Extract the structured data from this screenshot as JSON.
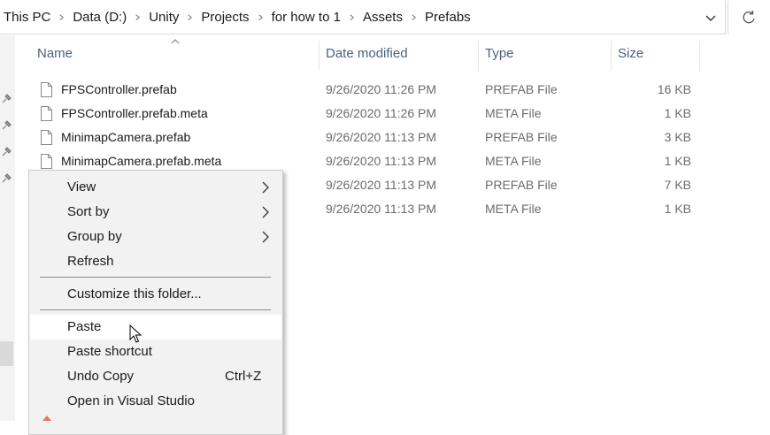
{
  "address": {
    "crumbs": [
      "This PC",
      "Data (D:)",
      "Unity",
      "Projects",
      "for how to 1",
      "Assets",
      "Prefabs"
    ]
  },
  "columns": {
    "name": "Name",
    "date": "Date modified",
    "type": "Type",
    "size": "Size"
  },
  "files": [
    {
      "name": "FPSController.prefab",
      "date": "9/26/2020 11:26 PM",
      "type": "PREFAB File",
      "size": "16 KB"
    },
    {
      "name": "FPSController.prefab.meta",
      "date": "9/26/2020 11:26 PM",
      "type": "META File",
      "size": "1 KB"
    },
    {
      "name": "MinimapCamera.prefab",
      "date": "9/26/2020 11:13 PM",
      "type": "PREFAB File",
      "size": "3 KB"
    },
    {
      "name": "MinimapCamera.prefab.meta",
      "date": "9/26/2020 11:13 PM",
      "type": "META File",
      "size": "1 KB"
    },
    {
      "name": "",
      "date": "9/26/2020 11:13 PM",
      "type": "PREFAB File",
      "size": "7 KB"
    },
    {
      "name": "",
      "date": "9/26/2020 11:13 PM",
      "type": "META File",
      "size": "1 KB"
    }
  ],
  "context_menu": {
    "view": "View",
    "sort_by": "Sort by",
    "group_by": "Group by",
    "refresh": "Refresh",
    "customize": "Customize this folder...",
    "paste": "Paste",
    "paste_shortcut": "Paste shortcut",
    "undo_copy": "Undo Copy",
    "undo_copy_shortcut": "Ctrl+Z",
    "open_vs": "Open in Visual Studio"
  },
  "colors": {
    "header_text": "#4d6082",
    "menu_bg": "#f2f2f2",
    "highlight": "#ffffff"
  }
}
